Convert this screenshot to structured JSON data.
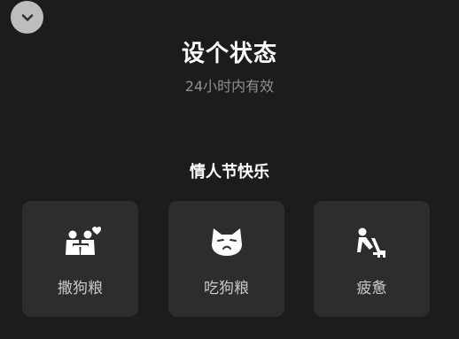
{
  "header": {
    "collapse_icon": "chevron-down-icon",
    "title": "设个状态",
    "subtitle": "24小时内有效"
  },
  "section": {
    "title": "情人节快乐"
  },
  "status_options": [
    {
      "label": "撒狗粮",
      "icon": "couple-hug-icon"
    },
    {
      "label": "吃狗粮",
      "icon": "grumpy-cat-icon"
    },
    {
      "label": "疲惫",
      "icon": "tired-person-icon"
    }
  ],
  "colors": {
    "background": "#1c1c1c",
    "card": "#2d2d2d",
    "title_text": "#ffffff",
    "subtitle_text": "#8f8f8f",
    "label_text": "#c8c8c8",
    "collapse_button": "#bdbdbd"
  }
}
